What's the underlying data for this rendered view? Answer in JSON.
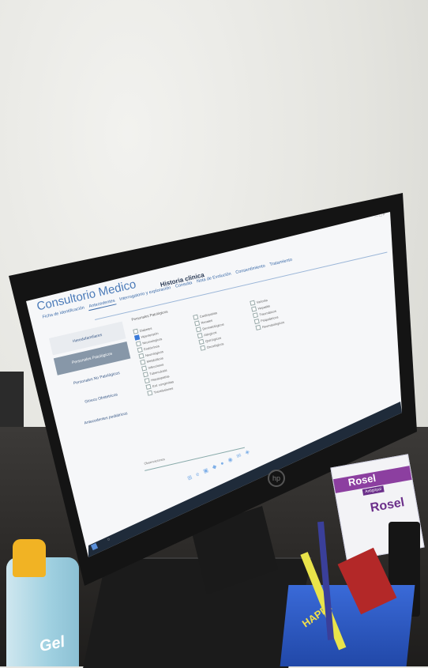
{
  "screen": {
    "app_title": "Consultorio Medico",
    "window_title": "Historia clinica",
    "tabs": [
      "Ficha de identificación",
      "Antecedentes",
      "Interrogatorio y exploración",
      "Consulta",
      "Nota de Evolución",
      "Consentimiento",
      "Tratamiento"
    ],
    "active_tab_index": 1,
    "sidebar": {
      "items": [
        "Heredofamiliares",
        "Personales Patológicos",
        "Personales No Patológicos",
        "Gineco Obstetricos",
        "Antecedentes pediátricos"
      ],
      "active_index": 1
    },
    "section_label": "Personales Patológicos",
    "checklist_col1": [
      "Diabetes",
      "Hipertensión",
      "Neumologicos",
      "Endócrinos",
      "Neurológicos",
      "Metabólicos",
      "Infecciosos",
      "Tuberculosis",
      "Hepatopatías",
      "Enf. congénitas",
      "Transfusiones"
    ],
    "checklist_col1_checked_index": 1,
    "checklist_col2": [
      "Cardiopatías",
      "Renales",
      "Dermatológicos",
      "Alérgicos",
      "Quirúrgicos",
      "Oncológicos"
    ],
    "checklist_col3": [
      "Varicela",
      "Hepatitis",
      "Traumáticos",
      "Psiquiátricos",
      "Reumatológicos"
    ],
    "observations_label": "Observaciones",
    "window_controls": "— □ ×"
  },
  "taskbar": {
    "icons": [
      "⊞",
      "e",
      "▣",
      "◆",
      "●",
      "◉",
      "✉",
      "◈"
    ]
  },
  "desk_items": {
    "gel_label": "Gel",
    "rosel_brand": "Rosel",
    "rosel_sub": "Antigripal",
    "cup_label": "HAPPY"
  },
  "colors": {
    "accent_blue": "#3a6aa8",
    "sidebar_active": "#8797a8",
    "rosel_purple": "#8c3fa0",
    "gel_cap": "#f1b324"
  }
}
